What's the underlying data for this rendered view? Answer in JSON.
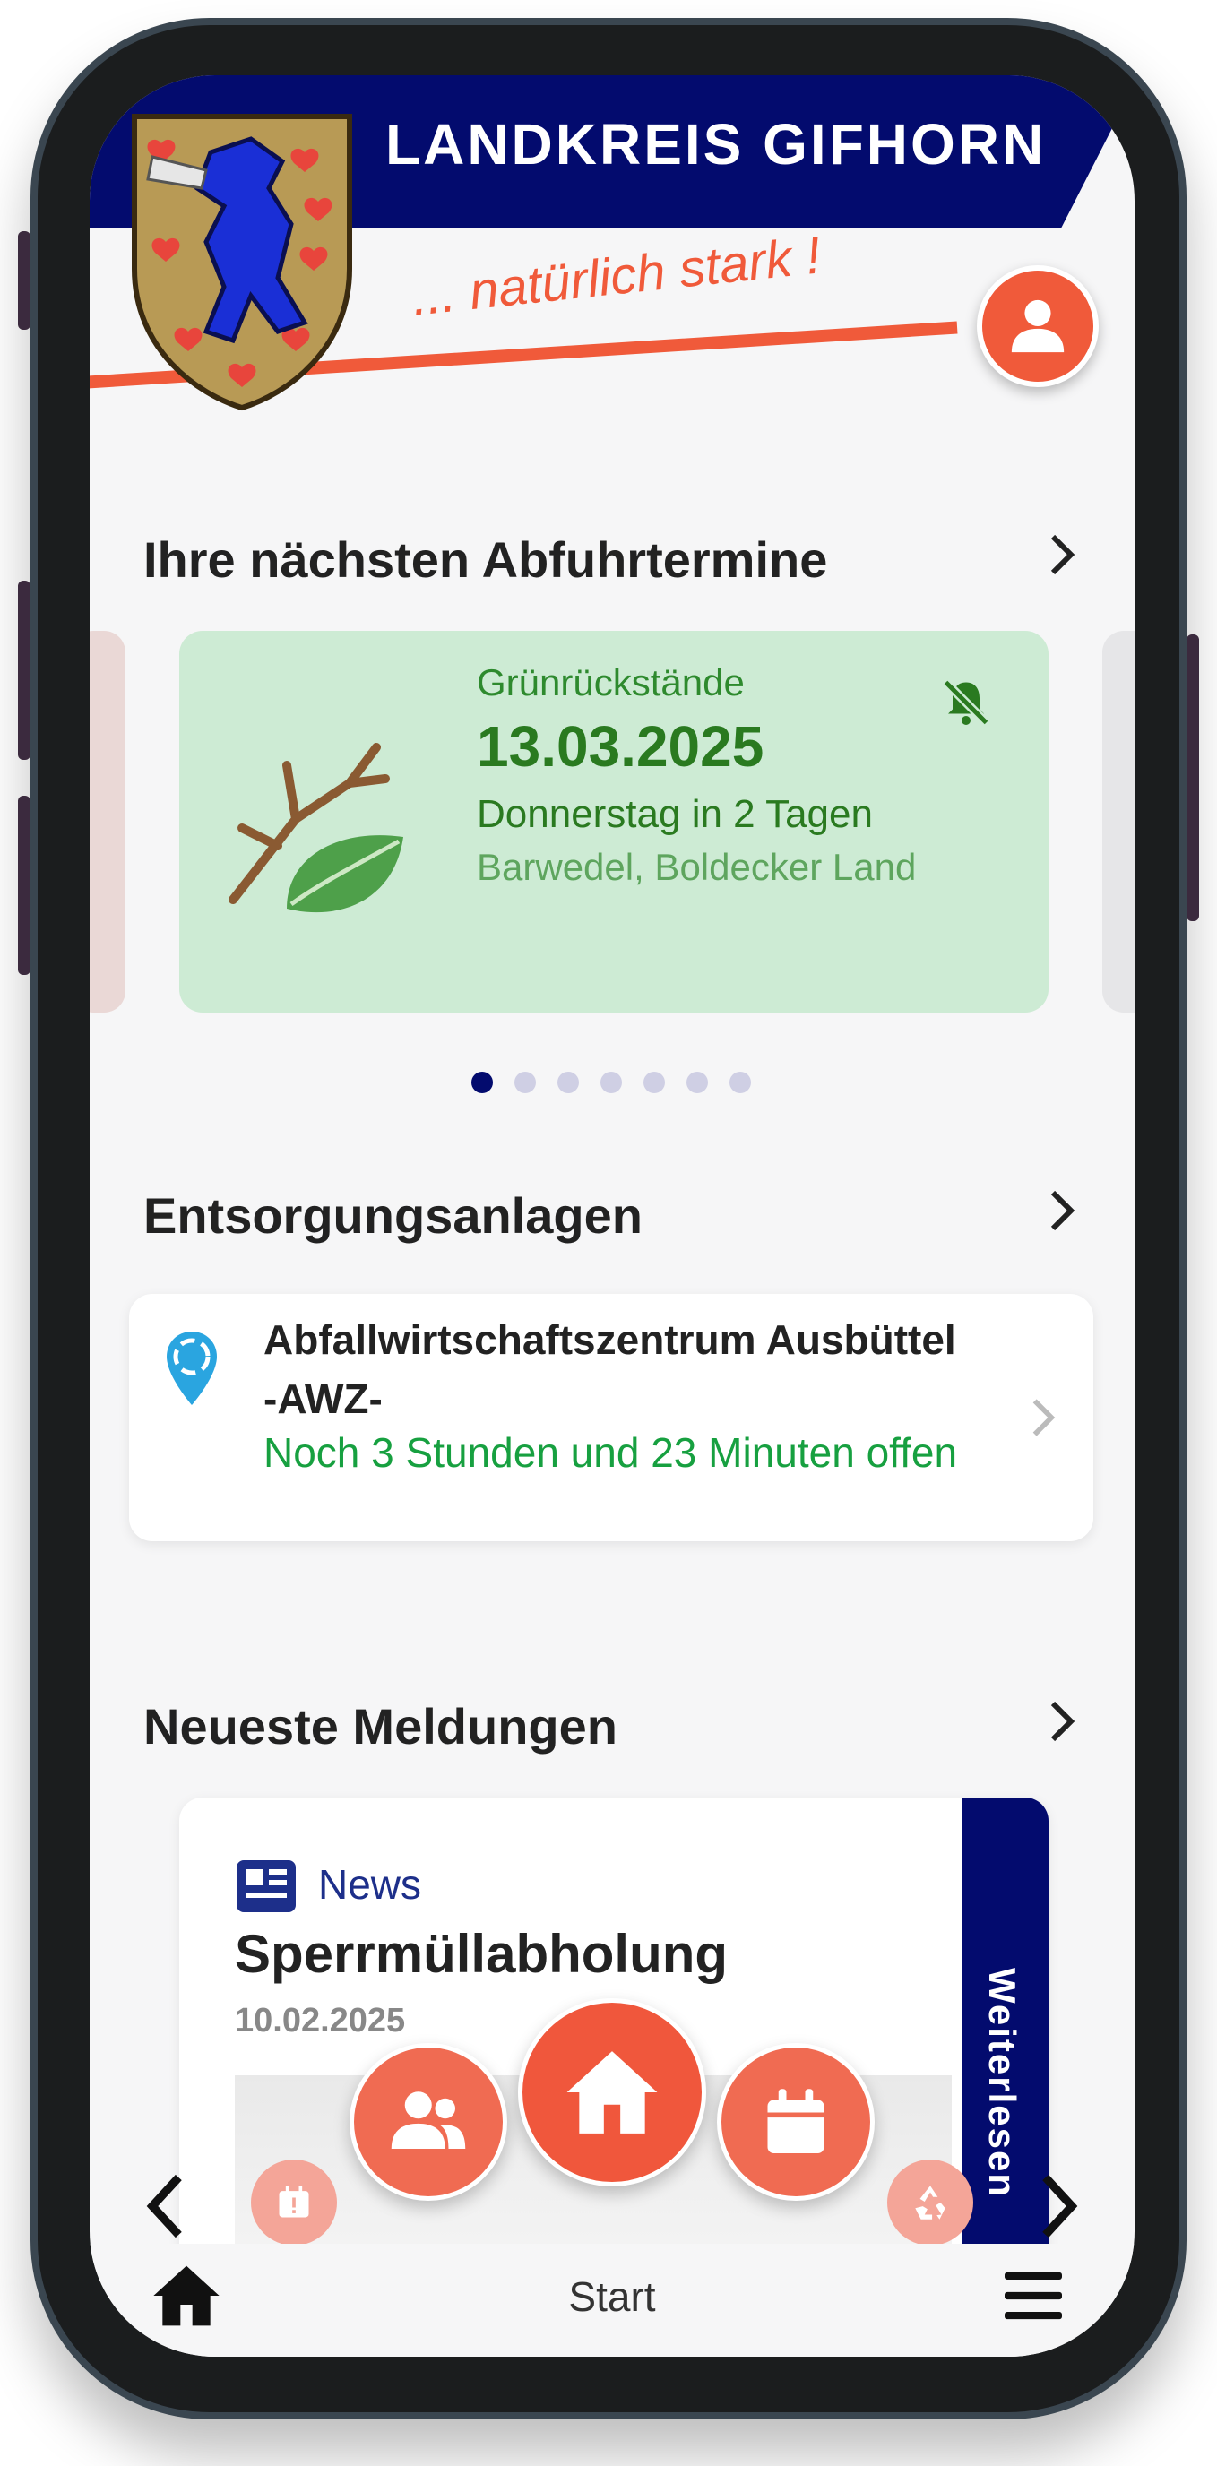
{
  "header": {
    "title": "LANDKREIS GIFHORN",
    "slogan": "... natürlich stark !"
  },
  "pickup_section": {
    "title": "Ihre nächsten Abfuhrtermine",
    "card": {
      "type": "Grünrückstände",
      "date": "13.03.2025",
      "day": "Donnerstag in 2 Tagen",
      "location": "Barwedel, Boldecker Land",
      "icon": "branch-leaf-icon",
      "notification_icon": "bell-off-icon"
    },
    "pagination": {
      "total": 7,
      "active": 1
    }
  },
  "facilities_section": {
    "title": "Entsorgungsanlagen",
    "facility": {
      "name": "Abfallwirtschaftszentrum Ausbüttel -AWZ-",
      "status": "Noch 3 Stunden und 23 Minuten offen",
      "icon": "recycling-pin-icon"
    }
  },
  "news_section": {
    "title": "Neueste Meldungen",
    "item": {
      "category": "News",
      "title": "Sperrmüllabholung",
      "date": "10.02.2025",
      "read_more": "Weiterlesen"
    }
  },
  "floating_nav": {
    "items": [
      "calendar-alert-icon",
      "people-icon",
      "home-icon",
      "calendar-icon",
      "recycle-icon"
    ]
  },
  "bottom_bar": {
    "label": "Start"
  },
  "colors": {
    "brand_blue": "#030b6e",
    "accent_red": "#f05a3a",
    "pickup_green_bg": "#cdebd4",
    "open_green": "#17a040"
  }
}
